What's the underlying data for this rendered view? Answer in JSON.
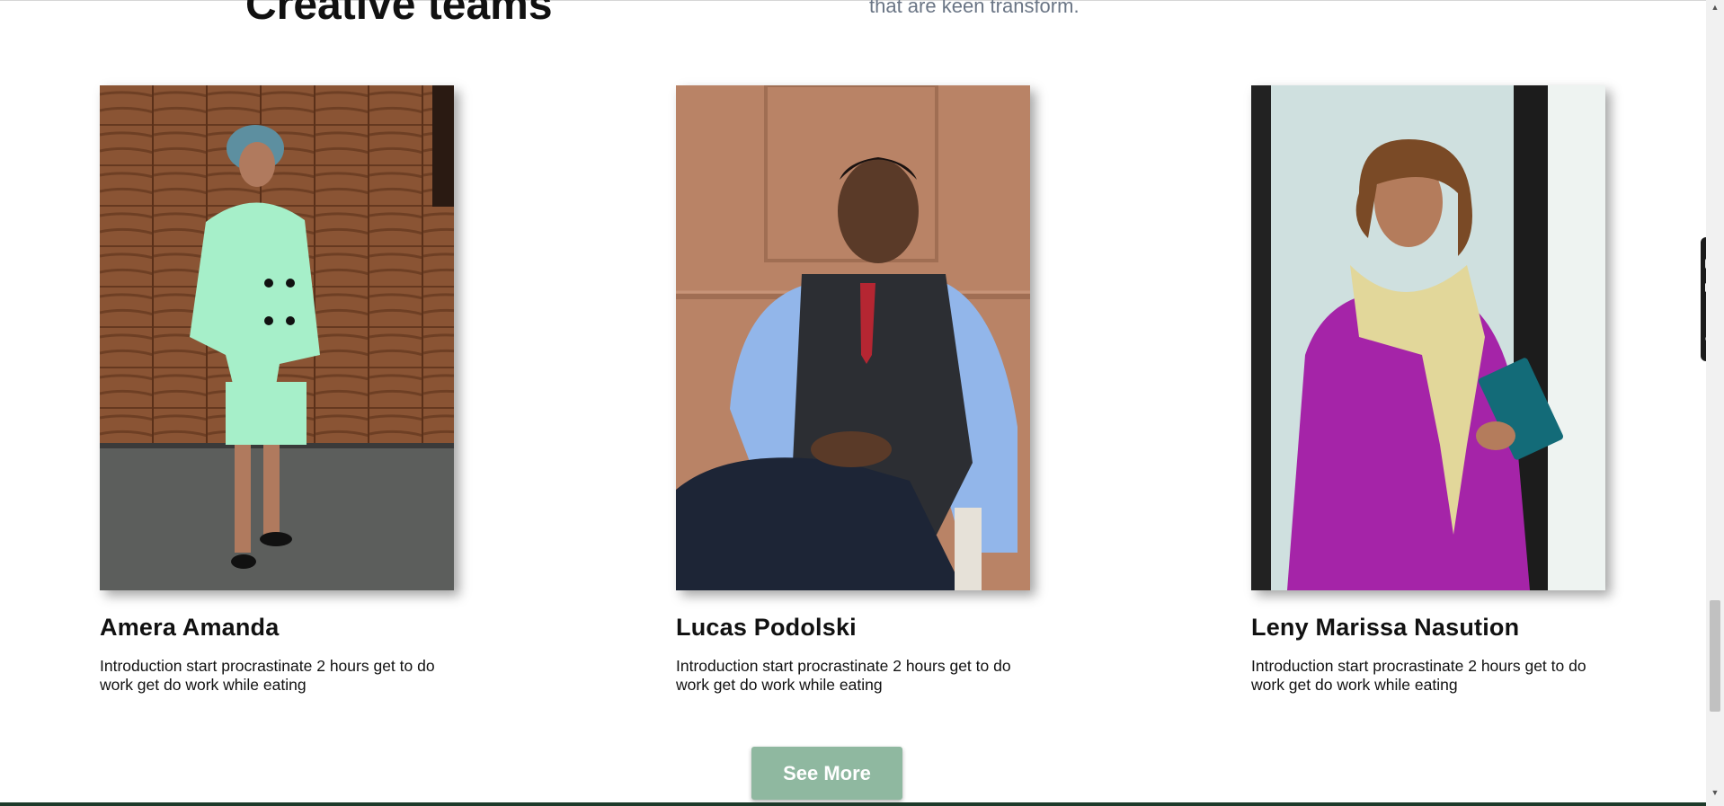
{
  "section": {
    "title": "Creative teams",
    "subtitle": "that are keen transform."
  },
  "members": [
    {
      "name": "Amera Amanda",
      "description": "Introduction start procrastinate 2 hours get to do work get do work while eating"
    },
    {
      "name": "Lucas Podolski",
      "description": "Introduction start procrastinate 2 hours get to do work get do work while eating"
    },
    {
      "name": "Leny Marissa Nasution",
      "description": "Introduction start procrastinate 2 hours get to do work get do work while eating"
    }
  ],
  "see_more_label": "See More",
  "toolbox": {
    "icons": [
      "capture-icon",
      "camera-icon",
      "video-icon",
      "window-icon",
      "gear-icon"
    ]
  },
  "colors": {
    "button": "#8fb8a0",
    "subtitle": "#6a7585",
    "footer": "#1d3a2a"
  }
}
